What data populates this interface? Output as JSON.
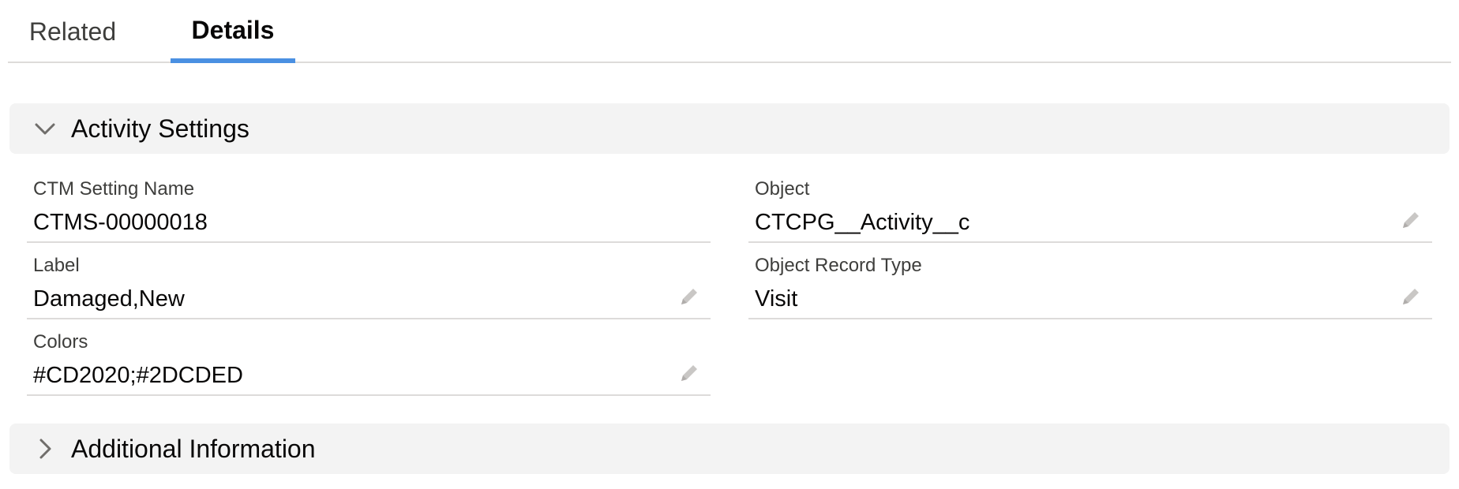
{
  "tabs": {
    "related": "Related",
    "details": "Details"
  },
  "sections": {
    "activity_settings": {
      "title": "Activity Settings",
      "expanded": true
    },
    "additional_information": {
      "title": "Additional Information",
      "expanded": false
    }
  },
  "fields": {
    "ctm_setting_name": {
      "label": "CTM Setting Name",
      "value": "CTMS-00000018",
      "editable": false
    },
    "object": {
      "label": "Object",
      "value": "CTCPG__Activity__c",
      "editable": true
    },
    "label": {
      "label": "Label",
      "value": "Damaged,New",
      "editable": true
    },
    "object_record_type": {
      "label": "Object Record Type",
      "value": "Visit",
      "editable": true
    },
    "colors": {
      "label": "Colors",
      "value": "#CD2020;#2DCDED",
      "editable": true
    }
  },
  "icons": {
    "expanded_chevron": "chevron-down-icon",
    "collapsed_chevron": "chevron-right-icon",
    "edit": "pencil-icon"
  },
  "colors": {
    "active_tab_underline": "#4a90e2",
    "section_background": "#f3f3f3",
    "divider": "#dddbda",
    "edit_icon": "#c9c7c5"
  }
}
